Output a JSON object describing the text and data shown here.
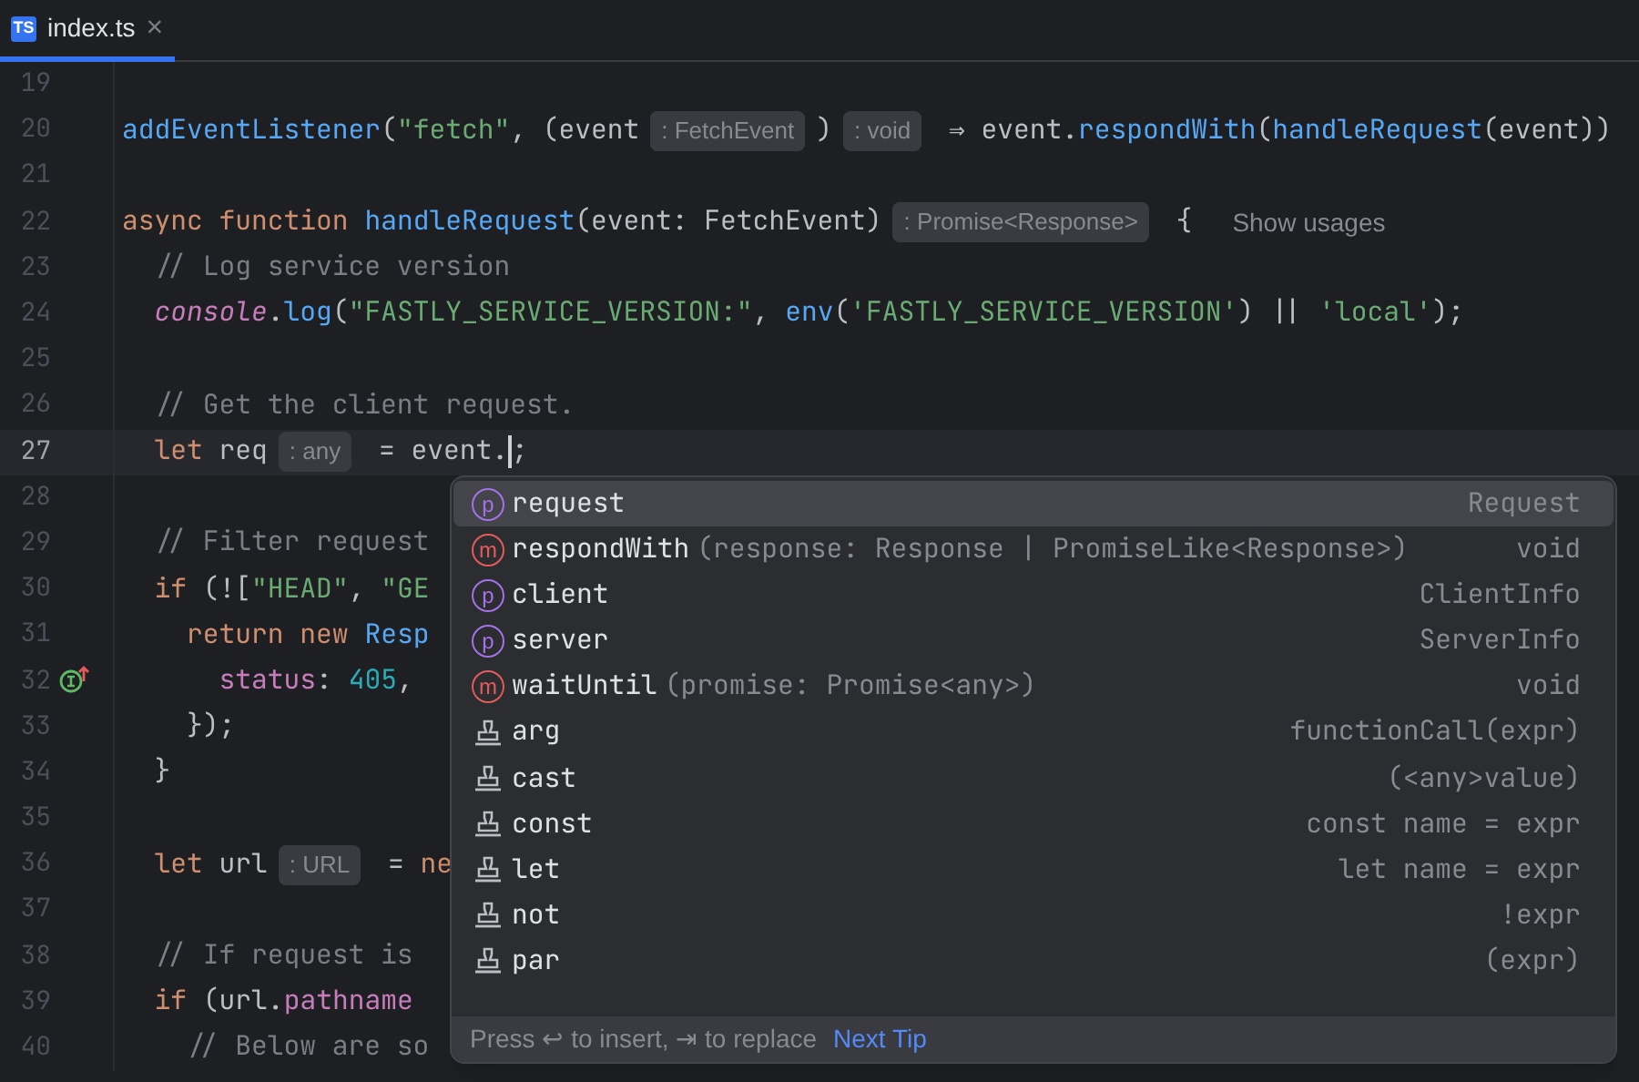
{
  "tab": {
    "icon": "TS",
    "label": "index.ts",
    "close": "×",
    "selected": true
  },
  "lines": [
    {
      "number": "19",
      "current": false,
      "implemented": false
    },
    {
      "number": "20",
      "current": false,
      "implemented": false,
      "tokens": [
        {
          "text": "addEventListener",
          "kind": "fn"
        },
        {
          "text": "(",
          "kind": "plain"
        },
        {
          "text": "\"fetch\"",
          "kind": "string"
        },
        {
          "text": ", (event",
          "kind": "plain"
        },
        {
          "text": ": FetchEvent",
          "kind": "hint"
        },
        {
          "text": ")",
          "kind": "plain"
        },
        {
          "text": ": void",
          "kind": "hint"
        },
        {
          "text": " ⇒ event.",
          "kind": "plain"
        },
        {
          "text": "respondWith",
          "kind": "fn"
        },
        {
          "text": "(",
          "kind": "plain"
        },
        {
          "text": "handleRequest",
          "kind": "fn"
        },
        {
          "text": "(event))",
          "kind": "plain"
        }
      ]
    },
    {
      "number": "21",
      "current": false,
      "implemented": false
    },
    {
      "number": "22",
      "current": false,
      "implemented": false,
      "tokens": [
        {
          "text": "async function ",
          "kind": "keyword"
        },
        {
          "text": "handleRequest",
          "kind": "fn"
        },
        {
          "text": "(event: FetchEvent)",
          "kind": "plain"
        },
        {
          "text": ": Promise<Response>",
          "kind": "hint"
        },
        {
          "text": " {",
          "kind": "plain"
        },
        {
          "text": "Show usages",
          "kind": "usages"
        }
      ]
    },
    {
      "number": "23",
      "current": false,
      "implemented": false,
      "tokens": [
        {
          "text": "  // Log service version",
          "kind": "comment"
        }
      ]
    },
    {
      "number": "24",
      "current": false,
      "implemented": false,
      "tokens": [
        {
          "text": "  console",
          "kind": "italic"
        },
        {
          "text": ".",
          "kind": "plain"
        },
        {
          "text": "log",
          "kind": "fn"
        },
        {
          "text": "(",
          "kind": "plain"
        },
        {
          "text": "\"FASTLY_SERVICE_VERSION:\"",
          "kind": "string"
        },
        {
          "text": ", ",
          "kind": "plain"
        },
        {
          "text": "env",
          "kind": "fn"
        },
        {
          "text": "(",
          "kind": "plain"
        },
        {
          "text": "'FASTLY_SERVICE_VERSION'",
          "kind": "string"
        },
        {
          "text": ") || ",
          "kind": "plain"
        },
        {
          "text": "'local'",
          "kind": "string"
        },
        {
          "text": ");",
          "kind": "plain"
        }
      ]
    },
    {
      "number": "25",
      "current": false,
      "implemented": false
    },
    {
      "number": "26",
      "current": false,
      "implemented": false,
      "tokens": [
        {
          "text": "  // Get the client request.",
          "kind": "comment"
        }
      ]
    },
    {
      "number": "27",
      "current": true,
      "implemented": false,
      "tokens": [
        {
          "text": "  let ",
          "kind": "keyword"
        },
        {
          "text": "req",
          "kind": "plain"
        },
        {
          "text": ": any",
          "kind": "hint"
        },
        {
          "text": " = event.",
          "kind": "plain"
        },
        {
          "text": ";",
          "kind": "plain",
          "cursor": true
        }
      ]
    },
    {
      "number": "28",
      "current": false,
      "implemented": false
    },
    {
      "number": "29",
      "current": false,
      "implemented": false,
      "tokens": [
        {
          "text": "  // Filter request",
          "kind": "comment"
        }
      ]
    },
    {
      "number": "30",
      "current": false,
      "implemented": false,
      "tokens": [
        {
          "text": "  if ",
          "kind": "keyword"
        },
        {
          "text": "(![",
          "kind": "plain"
        },
        {
          "text": "\"HEAD\"",
          "kind": "string"
        },
        {
          "text": ", ",
          "kind": "plain"
        },
        {
          "text": "\"GE",
          "kind": "string"
        }
      ]
    },
    {
      "number": "31",
      "current": false,
      "implemented": false,
      "tokens": [
        {
          "text": "    return new ",
          "kind": "keyword"
        },
        {
          "text": "Resp",
          "kind": "fn"
        }
      ]
    },
    {
      "number": "32",
      "current": false,
      "implemented": true,
      "tokens": [
        {
          "text": "      status",
          "kind": "prop"
        },
        {
          "text": ": ",
          "kind": "plain"
        },
        {
          "text": "405",
          "kind": "number"
        },
        {
          "text": ",",
          "kind": "plain"
        }
      ]
    },
    {
      "number": "33",
      "current": false,
      "implemented": false,
      "tokens": [
        {
          "text": "    });",
          "kind": "plain"
        }
      ]
    },
    {
      "number": "34",
      "current": false,
      "implemented": false,
      "tokens": [
        {
          "text": "  }",
          "kind": "plain"
        }
      ]
    },
    {
      "number": "35",
      "current": false,
      "implemented": false
    },
    {
      "number": "36",
      "current": false,
      "implemented": false,
      "tokens": [
        {
          "text": "  let ",
          "kind": "keyword"
        },
        {
          "text": "url",
          "kind": "plain"
        },
        {
          "text": ": URL",
          "kind": "hint"
        },
        {
          "text": " = ",
          "kind": "plain"
        },
        {
          "text": "ne",
          "kind": "keyword"
        }
      ]
    },
    {
      "number": "37",
      "current": false,
      "implemented": false
    },
    {
      "number": "38",
      "current": false,
      "implemented": false,
      "tokens": [
        {
          "text": "  // If request is",
          "kind": "comment"
        }
      ]
    },
    {
      "number": "39",
      "current": false,
      "implemented": false,
      "tokens": [
        {
          "text": "  if ",
          "kind": "keyword"
        },
        {
          "text": "(url.",
          "kind": "plain"
        },
        {
          "text": "pathname",
          "kind": "prop"
        }
      ]
    },
    {
      "number": "40",
      "current": false,
      "implemented": false,
      "tokens": [
        {
          "text": "    // Below are so",
          "kind": "comment"
        }
      ]
    }
  ],
  "completion": {
    "items": [
      {
        "kind": "property",
        "badge": "p",
        "name": "request",
        "type": "Request",
        "selected": true
      },
      {
        "kind": "method",
        "badge": "m",
        "name": "respondWith",
        "params": "(response: Response | PromiseLike<Response>)",
        "type": "void",
        "selected": false
      },
      {
        "kind": "property",
        "badge": "p",
        "name": "client",
        "type": "ClientInfo",
        "selected": false
      },
      {
        "kind": "property",
        "badge": "p",
        "name": "server",
        "type": "ServerInfo",
        "selected": false
      },
      {
        "kind": "method",
        "badge": "m",
        "name": "waitUntil",
        "params": "(promise: Promise<any>)",
        "type": "void",
        "selected": false
      },
      {
        "kind": "template",
        "name": "arg",
        "type": "functionCall(expr)",
        "selected": false
      },
      {
        "kind": "template",
        "name": "cast",
        "type": "(<any>value)",
        "selected": false
      },
      {
        "kind": "template",
        "name": "const",
        "type": "const name = expr",
        "selected": false
      },
      {
        "kind": "template",
        "name": "let",
        "type": "let name = expr",
        "selected": false
      },
      {
        "kind": "template",
        "name": "not",
        "type": "!expr",
        "selected": false
      },
      {
        "kind": "template",
        "name": "par",
        "type": "(expr)",
        "selected": false
      }
    ],
    "footer": {
      "hint": "Press ↩ to insert, ⇥ to replace",
      "link": "Next Tip"
    }
  }
}
